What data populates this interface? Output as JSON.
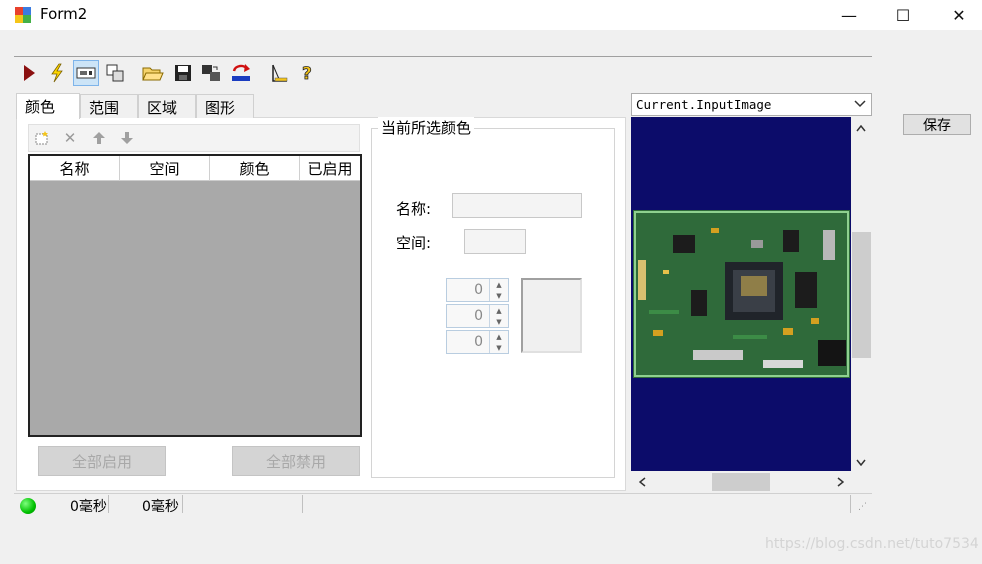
{
  "window": {
    "title": "Form2",
    "minimize": "—",
    "maximize": "☐",
    "close": "✕"
  },
  "toolbar": {
    "icons": [
      "run-icon",
      "lightning-icon",
      "image-view-icon",
      "copy-icon",
      "open-folder-icon",
      "save-disk-icon",
      "transfer-icon",
      "reset-icon",
      "ruler-icon",
      "help-icon"
    ]
  },
  "tabs": [
    {
      "label": "颜色",
      "selected": true
    },
    {
      "label": "范围",
      "selected": false
    },
    {
      "label": "区域",
      "selected": false
    },
    {
      "label": "图形",
      "selected": false
    }
  ],
  "color_list": {
    "columns": [
      "名称",
      "空间",
      "颜色",
      "已启用"
    ],
    "rows": [],
    "enable_all": "全部启用",
    "disable_all": "全部禁用"
  },
  "current_color": {
    "group_title": "当前所选颜色",
    "name_label": "名称:",
    "name_value": "",
    "space_label": "空间:",
    "space_value": "",
    "channels": [
      "0",
      "0",
      "0"
    ]
  },
  "image_viewer": {
    "source": "Current.InputImage",
    "background_color": "#0c0c6a"
  },
  "save_button": "保存",
  "status": {
    "indicator_color": "#00c000",
    "time1": "0毫秒",
    "time2": "0毫秒"
  },
  "watermark": "https://blog.csdn.net/tuto7534"
}
